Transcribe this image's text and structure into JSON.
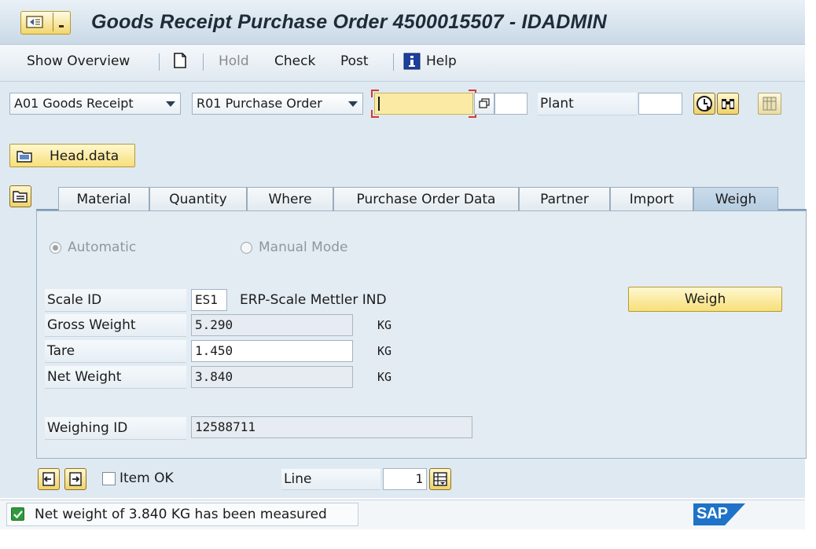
{
  "window": {
    "title": "Goods Receipt Purchase Order 4500015507 - IDADMIN"
  },
  "toolbar": {
    "show_overview": "Show Overview",
    "hold": "Hold",
    "check": "Check",
    "post": "Post",
    "help": "Help"
  },
  "header": {
    "action_select": "A01 Goods Receipt",
    "reference_select": "R01 Purchase Order",
    "po_number_value": "",
    "plant_label": "Plant",
    "plant_value": ""
  },
  "head_data_button": "Head.data",
  "tabs": [
    {
      "label": "Material",
      "active": false
    },
    {
      "label": "Quantity",
      "active": false
    },
    {
      "label": "Where",
      "active": false
    },
    {
      "label": "Purchase Order Data",
      "active": false
    },
    {
      "label": "Partner",
      "active": false
    },
    {
      "label": "Import",
      "active": false
    },
    {
      "label": "Weigh",
      "active": true
    }
  ],
  "weigh": {
    "mode_automatic": "Automatic",
    "mode_manual": "Manual Mode",
    "scale_id_label": "Scale ID",
    "scale_id_value": "ES1",
    "scale_id_desc": "ERP-Scale Mettler IND",
    "weigh_button": "Weigh",
    "gross_label": "Gross Weight",
    "gross_value": "5.290",
    "gross_unit": "KG",
    "tare_label": "Tare",
    "tare_value": "1.450",
    "tare_unit": "KG",
    "net_label": "Net Weight",
    "net_value": "3.840",
    "net_unit": "KG",
    "weighing_id_label": "Weighing ID",
    "weighing_id_value": "12588711"
  },
  "footer": {
    "item_ok_label": "Item OK",
    "line_label": "Line",
    "line_value": "1"
  },
  "status": {
    "message": "Net weight of 3.840 KG has been measured",
    "brand": "SAP"
  },
  "colors": {
    "accent_yellow": "#f7df79",
    "panel_blue": "#dfe9f2",
    "success_green": "#2f9a3b",
    "sap_blue": "#1e73c8"
  }
}
